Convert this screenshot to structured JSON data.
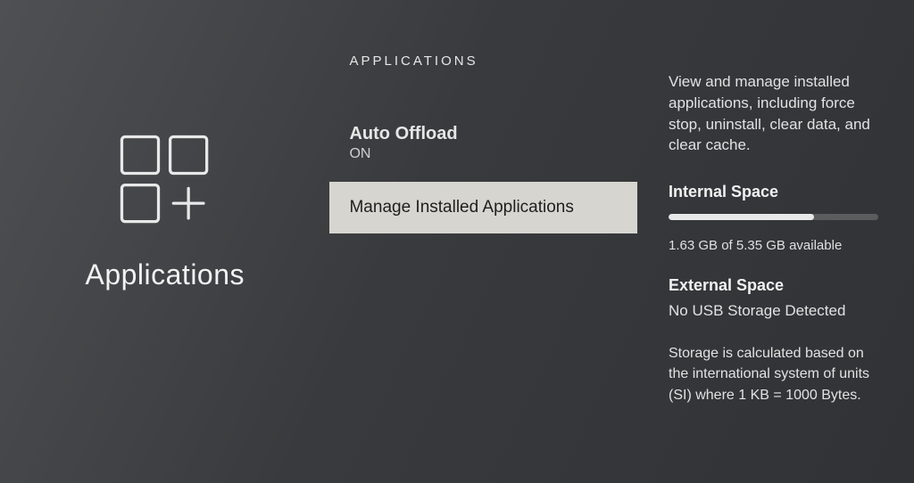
{
  "left": {
    "title": "Applications"
  },
  "mid": {
    "header": "APPLICATIONS",
    "items": [
      {
        "title": "Auto Offload",
        "sub": "ON"
      },
      {
        "title": "Manage Installed Applications"
      }
    ]
  },
  "right": {
    "desc": "View and manage installed applications, including force stop, uninstall, clear data, and clear cache.",
    "internal": {
      "title": "Internal Space",
      "used_gb": 1.63,
      "total_gb": 5.35,
      "caption": "1.63 GB of 5.35 GB available"
    },
    "external": {
      "title": "External Space",
      "value": "No USB Storage Detected"
    },
    "footnote": "Storage is calculated based on the international system of units (SI) where 1 KB = 1000 Bytes."
  }
}
